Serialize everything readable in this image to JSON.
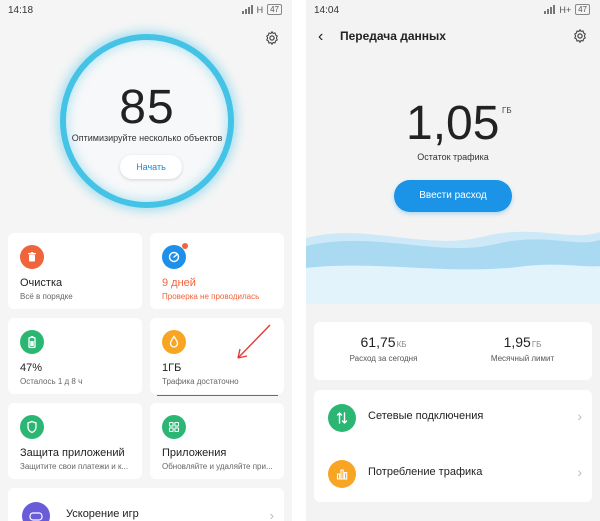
{
  "left": {
    "status": {
      "time": "14:18",
      "signal": "H",
      "battery": "47"
    },
    "settings_icon": "gear-icon",
    "score": {
      "value": "85",
      "subtitle": "Оптимизируйте несколько объектов",
      "button": "Начать",
      "ring_color": "#45c3e6"
    },
    "cards": [
      {
        "title": "Очистка",
        "subtitle": "Всё в порядке",
        "icon": "trash-icon",
        "color": "#f0643c"
      },
      {
        "title": "9 дней",
        "subtitle": "Проверка не проводилась",
        "icon": "speed-icon",
        "color": "#1e90e8",
        "alert_color": "#f0643c"
      },
      {
        "title": "47%",
        "subtitle": "Осталось 1 д 8 ч",
        "icon": "battery-icon",
        "color": "#2bb673"
      },
      {
        "title": "1ГБ",
        "subtitle": "Трафика достаточно",
        "icon": "drop-icon",
        "color": "#f7a523"
      },
      {
        "title": "Защита приложений",
        "subtitle": "Защитите свои платежи и к...",
        "icon": "shield-icon",
        "color": "#2bb673"
      },
      {
        "title": "Приложения",
        "subtitle": "Обновляйте и удаляйте при...",
        "icon": "grid-icon",
        "color": "#2bb673"
      },
      {
        "title": "Ускорение игр",
        "icon": "gamepad-icon",
        "color": "#6a5cd8"
      }
    ],
    "annotation_color": "#e53935"
  },
  "right": {
    "status": {
      "time": "14:04",
      "signal": "H+",
      "battery": "47"
    },
    "header": {
      "title": "Передача данных"
    },
    "traffic": {
      "value": "1,05",
      "unit": "ГБ",
      "label": "Остаток трафика"
    },
    "cta": "Ввести расход",
    "stats": [
      {
        "value": "61,75",
        "unit": "КБ",
        "label": "Расход за сегодня"
      },
      {
        "value": "1,95",
        "unit": "ГБ",
        "label": "Месячный лимит"
      }
    ],
    "menu": [
      {
        "label": "Сетевые подключения",
        "icon": "arrows-updown-icon",
        "color": "#2bb673"
      },
      {
        "label": "Потребление трафика",
        "icon": "bar-chart-icon",
        "color": "#f7a523"
      }
    ],
    "accent": "#1b94e8"
  }
}
